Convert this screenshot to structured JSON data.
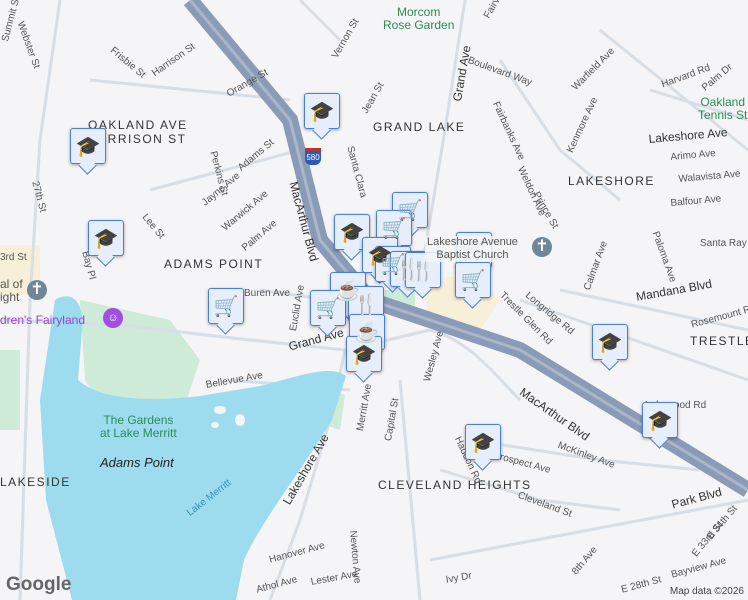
{
  "colors": {
    "water": "#9ddcef",
    "freeway": "#8a9bb7",
    "road": "#d8dee6",
    "park": "#c8ecd4",
    "marker_border": "#4a7fd6",
    "marker_fill": "#e6eefc",
    "marker_icon": "#1f4b7a"
  },
  "areas": [
    "GRAND LAKE",
    "LAKESHORE",
    "ADAMS POINT",
    "CLEVELAND HEIGHTS",
    "TRESTLE",
    "OAKLAND AVE\nHARRISON ST",
    "LAKESIDE"
  ],
  "pois": {
    "morcom": "Morcom\nRose Garden",
    "oakland_tennis": "Oakland\nTennis St",
    "fairyland": "dren's Fairyland",
    "gardens": "The Gardens\nat Lake Merritt",
    "adams_point": "Adams Point",
    "lake_merritt": "Lake Merritt",
    "church": "Lakeshore Avenue\nBaptist Church",
    "cathedral": "al of\night"
  },
  "streets": [
    "Harrison St",
    "Orange St",
    "Vernon St",
    "Jean St",
    "Grand Ave",
    "Boulevard Way",
    "Fairview",
    "Palm Dr",
    "Warfield Ave",
    "Harvard Rd",
    "Fairbanks Ave",
    "Kenmore Ave",
    "Lakeshore Ave",
    "Arimo Ave",
    "Walavista Ave",
    "Balfour Ave",
    "Santa Ray",
    "Weldon Ave",
    "Prince St",
    "Calmar Ave",
    "Paloma Ave",
    "Mandana Blvd",
    "Longridge Rd",
    "Trestle Glen Rd",
    "Rosemount Rd",
    "Perkins St",
    "Adams St",
    "Jayne Ave",
    "Warwick Ave",
    "Palm Ave",
    "Lee St",
    "MacArthur Blvd",
    "Santa Clara",
    "27th St",
    "Bay Pl",
    "Frisbie St",
    "Webster St",
    "Summit St",
    "3rd St",
    "Buren Ave",
    "Euclid Ave",
    "Grand Ave",
    "Bellevue Ave",
    "Wesley Ave",
    "Capital St",
    "Merritt Ave",
    "Haddon Rd",
    "Prospect Ave",
    "McKinley Ave",
    "MacArthur Blvd",
    "Lakeshore Ave",
    "Cleveland St",
    "Park Blvd",
    "E 34th St",
    "E 33rd St",
    "Bayview Ave",
    "E 28th St",
    "8th Ave",
    "Ivy Dr",
    "Hanover Ave",
    "Lester Ave",
    "Newton Ave",
    "Athol Ave",
    "Lakewood Rd"
  ],
  "highway_shield": "580",
  "markers": [
    "school",
    "school",
    "school",
    "school",
    "school",
    "school",
    "school",
    "school",
    "cart",
    "cart",
    "cart",
    "cart",
    "cart",
    "cart",
    "food",
    "food",
    "food",
    "coffee",
    "cart",
    "school"
  ],
  "attribution": {
    "logo": "Google",
    "text": "Map data ©2026"
  }
}
